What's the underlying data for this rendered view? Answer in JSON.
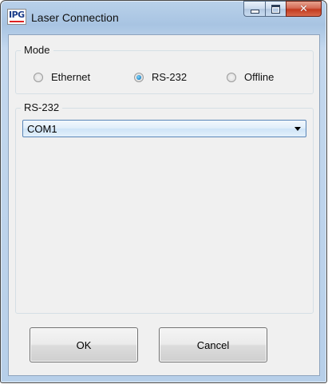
{
  "window": {
    "title": "Laser Connection",
    "logo_text": "IPG",
    "close_glyph": "✕"
  },
  "mode_group": {
    "label": "Mode",
    "options": [
      {
        "label": "Ethernet",
        "checked": false
      },
      {
        "label": "RS-232",
        "checked": true
      },
      {
        "label": "Offline",
        "checked": false
      }
    ]
  },
  "rs232_group": {
    "label": "RS-232",
    "port_value": "COM1"
  },
  "buttons": {
    "ok": "OK",
    "cancel": "Cancel"
  },
  "icons": {
    "app": "ipg-logo-icon",
    "minimize": "minimize-icon",
    "maximize": "maximize-icon",
    "close": "close-icon",
    "dropdown": "chevron-down-icon"
  }
}
